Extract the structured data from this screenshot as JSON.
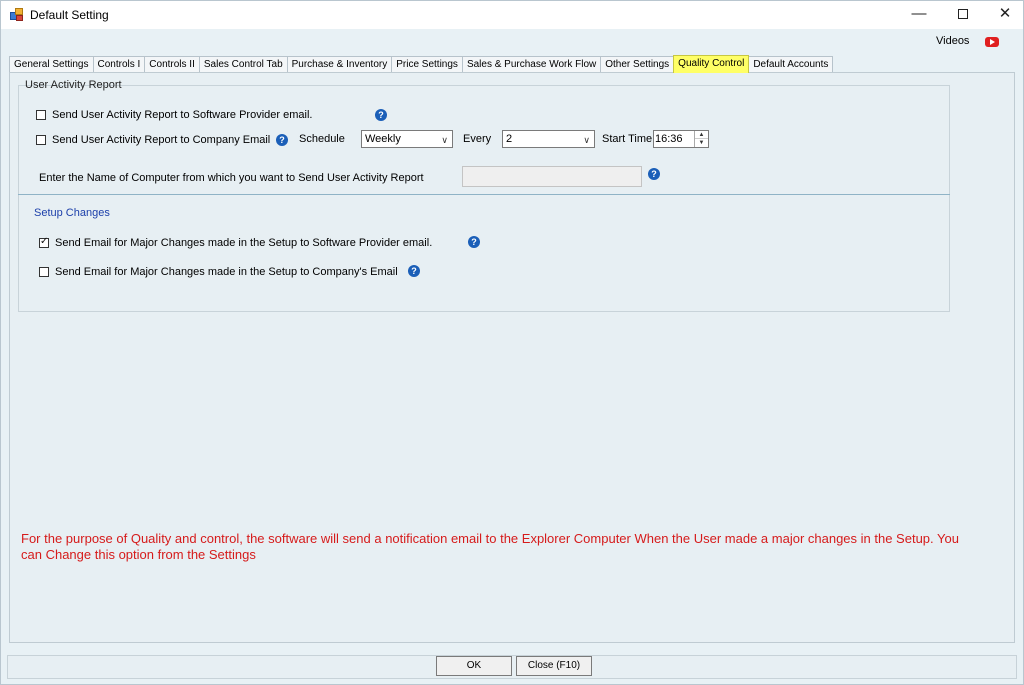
{
  "window": {
    "title": "Default Setting",
    "minimize_glyph": "—",
    "close_glyph": "✕"
  },
  "header": {
    "videos_label": "Videos",
    "youtube_icon": "youtube-icon"
  },
  "tabs": [
    {
      "label": "General Settings"
    },
    {
      "label": "Controls I"
    },
    {
      "label": "Controls II"
    },
    {
      "label": "Sales Control Tab"
    },
    {
      "label": "Purchase & Inventory"
    },
    {
      "label": "Price Settings"
    },
    {
      "label": "Sales & Purchase Work Flow"
    },
    {
      "label": "Other Settings"
    },
    {
      "label": "Quality Control",
      "active": true
    },
    {
      "label": "Default Accounts"
    }
  ],
  "user_activity": {
    "group_title": "User Activity Report",
    "send_to_provider_label": "Send User Activity Report to Software Provider email.",
    "send_to_provider_checked": false,
    "send_to_company_label": "Send User Activity Report to Company Email",
    "send_to_company_checked": false,
    "schedule_label": "Schedule",
    "schedule_value": "Weekly",
    "every_label": "Every",
    "every_value": "2",
    "start_time_label": "Start Time",
    "start_time_value": "16:36",
    "computer_name_label": "Enter the Name of Computer from which you want to  Send User Activity Report",
    "computer_name_value": ""
  },
  "setup_changes": {
    "title": "Setup Changes",
    "email_provider_label": "Send Email for Major Changes made in the Setup to Software Provider email.",
    "email_provider_checked": true,
    "email_company_label": "Send Email for Major Changes made in the Setup to Company's Email",
    "email_company_checked": false
  },
  "notice": "For the purpose of Quality and control, the software will send a notification email to the Explorer Computer When the User made a major changes in the Setup. You can Change this option from the Settings",
  "footer": {
    "ok_label": "OK",
    "close_label": "Close (F10)"
  },
  "help_glyph": "?",
  "colors": {
    "active_tab": "#ffff66",
    "notice_text": "#d61b1b",
    "section_title": "#1c3faa",
    "help_icon": "#1b5fb8"
  }
}
